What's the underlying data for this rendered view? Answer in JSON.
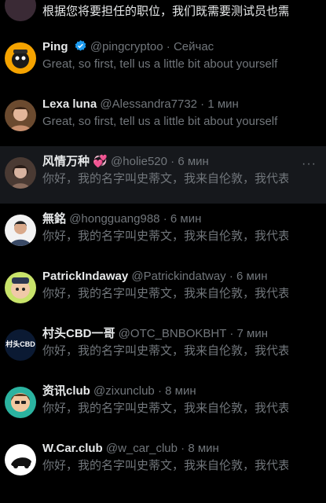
{
  "conversations": [
    {
      "name": "",
      "handle": "",
      "time": "",
      "preview": "根据您将要担任的职位，我们既需要测试员也需"
    },
    {
      "name": "Ping",
      "handle": "@pingcryptoo",
      "time": "Сейчас",
      "preview": "Great, so first, tell us a little bit about yourself",
      "verified": true
    },
    {
      "name": "Lexa luna",
      "handle": "@Alessandra7732",
      "time": "1 мин",
      "preview": "Great, so first, tell us a little bit about yourself"
    },
    {
      "name": "风情万种",
      "handle": "@holie520",
      "time": "6 мин",
      "preview": "你好，我的名字叫史蒂文，我来自伦敦，我代表我",
      "emoji": "💞",
      "more": "···"
    },
    {
      "name": "無銘",
      "handle": "@hongguang988",
      "time": "6 мин",
      "preview": "你好，我的名字叫史蒂文，我来自伦敦，我代表"
    },
    {
      "name": "PatrickIndaway",
      "handle": "@Patrickindatway",
      "time": "6 мин",
      "preview": "你好，我的名字叫史蒂文，我来自伦敦，我代表"
    },
    {
      "name": "村头CBD一哥",
      "handle": "@OTC_BNBOKBHT",
      "time": "7 мин",
      "preview": "你好，我的名字叫史蒂文，我来自伦敦，我代表",
      "avatar_text": "村头CBD"
    },
    {
      "name": "资讯club",
      "handle": "@zixunclub",
      "time": "8 мин",
      "preview": "你好，我的名字叫史蒂文，我来自伦敦，我代表"
    },
    {
      "name": "W.Car.club",
      "handle": "@w_car_club",
      "time": "8 мин",
      "preview": "你好，我的名字叫史蒂文，我来自伦敦，我代表"
    }
  ],
  "separator": " · ",
  "colors": {
    "background": "#000000",
    "highlight": "#16181c",
    "muted": "#71767b",
    "text": "#e7e9ea",
    "verified": "#1d9bf0"
  }
}
